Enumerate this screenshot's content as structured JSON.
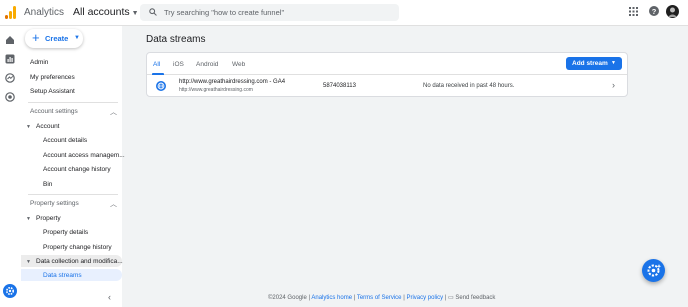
{
  "topbar": {
    "app_name": "Analytics",
    "account_label": "All accounts",
    "search_placeholder": "Try searching \"how to create funnel\""
  },
  "nav": {
    "create_label": "Create",
    "items": [
      "Admin",
      "My preferences",
      "Setup Assistant"
    ],
    "account_settings": {
      "heading": "Account settings",
      "group": "Account",
      "children": [
        "Account details",
        "Account access managem...",
        "Account change history",
        "Bin"
      ]
    },
    "property_settings": {
      "heading": "Property settings",
      "group": "Property",
      "children": [
        "Property details",
        "Property change history"
      ],
      "collection_group": "Data collection and modifica...",
      "active_child": "Data streams"
    }
  },
  "main": {
    "title": "Data streams",
    "tabs": [
      "All",
      "iOS",
      "Android",
      "Web"
    ],
    "active_tab": "All",
    "add_stream_label": "Add stream",
    "streams": [
      {
        "name": "http://www.greathairdressing.com - GA4",
        "url": "http://www.greathairdressing.com",
        "id": "5874038113",
        "status": "No data received in past 48 hours."
      }
    ]
  },
  "footer": {
    "copyright": "©2024 Google |",
    "links": [
      "Analytics home",
      "Terms of Service",
      "Privacy policy"
    ],
    "feedback": "Send feedback"
  },
  "colors": {
    "accent": "#1a73e8",
    "logo_orange": "#f9ab00",
    "logo_dark": "#e37400"
  }
}
